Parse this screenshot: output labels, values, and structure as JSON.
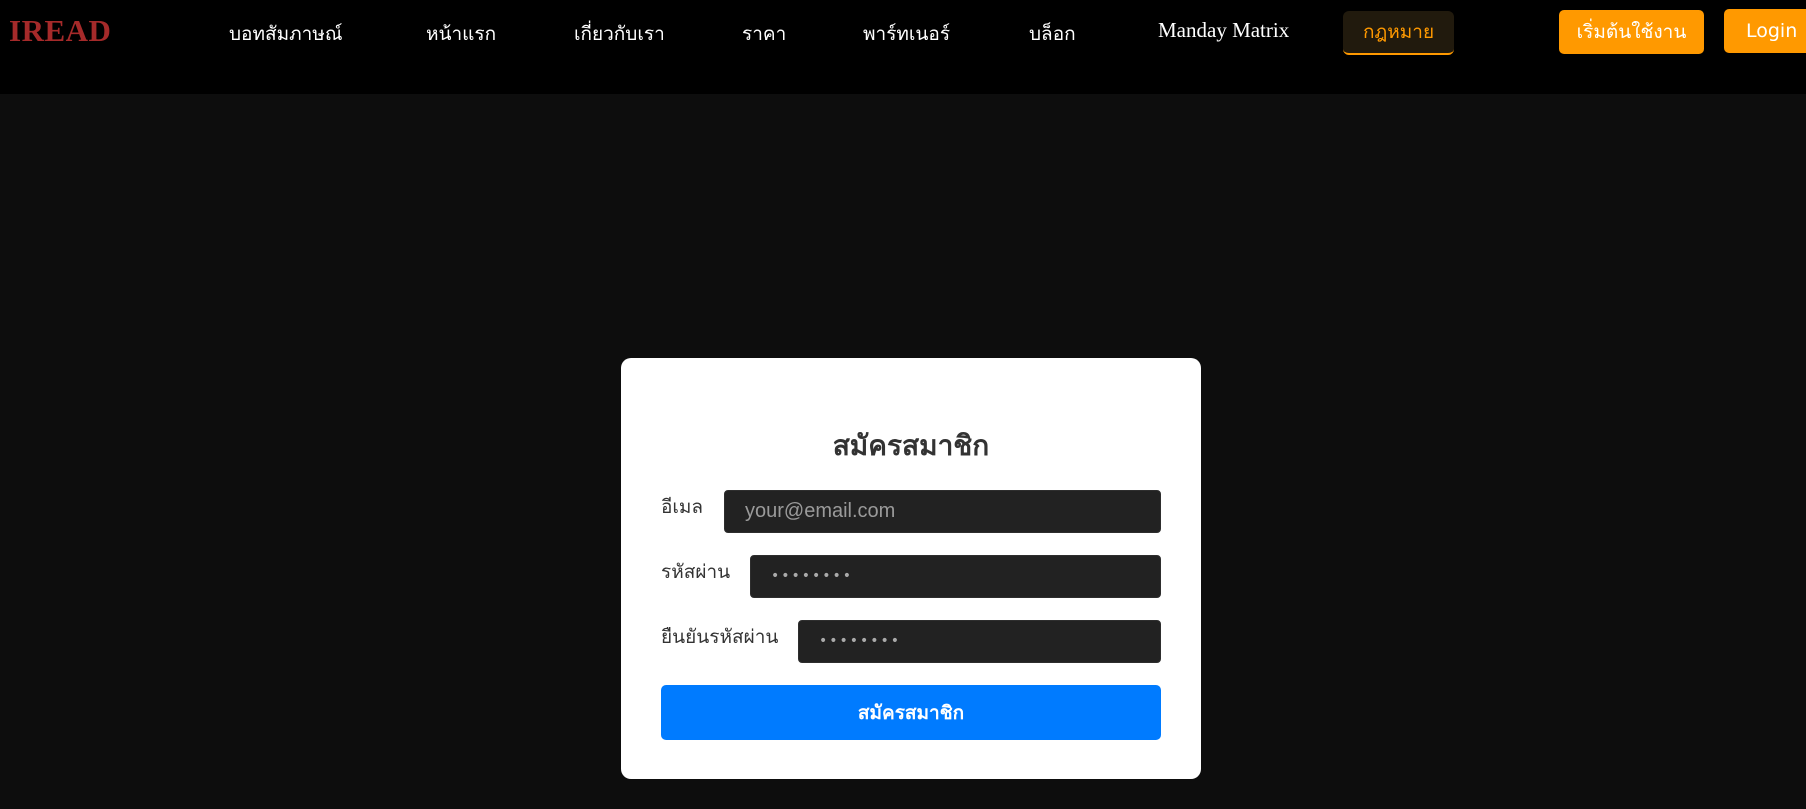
{
  "brand": {
    "logo": "IREAD"
  },
  "nav": {
    "items": [
      {
        "label": "บอทสัมภาษณ์"
      },
      {
        "label": "หน้าแรก"
      },
      {
        "label": "เกี่ยวกับเรา"
      },
      {
        "label": "ราคา"
      },
      {
        "label": "พาร์ทเนอร์"
      },
      {
        "label": "บล็อก"
      },
      {
        "label": "Manday Matrix"
      },
      {
        "label": "กฎหมาย",
        "active": true
      }
    ],
    "cta_label": "เริ่มต้นใช้งาน",
    "login_label": "Login"
  },
  "form": {
    "title": "สมัครสมาชิก",
    "email_label": "อีเมล",
    "email_placeholder": "your@email.com",
    "password_label": "รหัสผ่าน",
    "password_mask": "••••••••",
    "confirm_label": "ยืนยันรหัสผ่าน",
    "confirm_mask": "••••••••",
    "submit_label": "สมัครสมาชิก"
  },
  "colors": {
    "accent": "#ff9900",
    "primary": "#007bff",
    "logo": "#a52a2a",
    "background": "#0d0d0d",
    "navbar": "#000000"
  }
}
